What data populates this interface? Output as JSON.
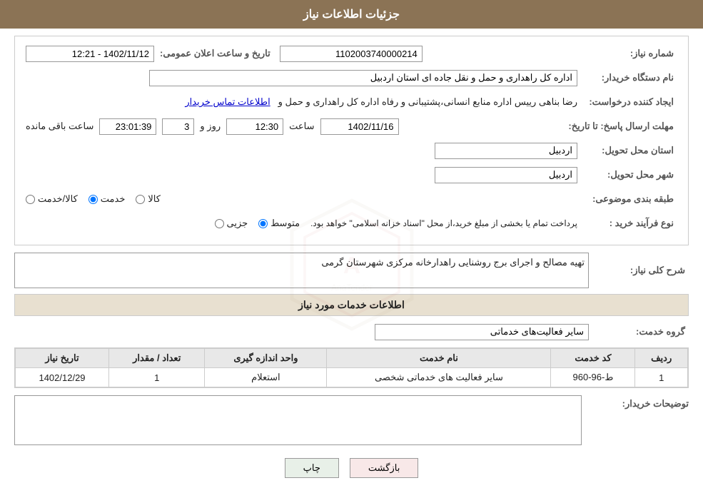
{
  "header": {
    "title": "جزئیات اطلاعات نیاز"
  },
  "fields": {
    "need_number_label": "شماره نیاز:",
    "need_number_value": "1102003740000214",
    "announce_datetime_label": "تاریخ و ساعت اعلان عمومی:",
    "announce_datetime_value": "1402/11/12 - 12:21",
    "buyer_org_label": "نام دستگاه خریدار:",
    "buyer_org_value": "اداره کل راهداری و حمل و نقل جاده ای استان اردبیل",
    "requester_label": "ایجاد کننده درخواست:",
    "requester_value": "رضا بناهی رییس اداره منابع انسانی،پشتیبانی و رفاه اداره کل راهداری و حمل و",
    "requester_link": "اطلاعات تماس خریدار",
    "reply_deadline_label": "مهلت ارسال پاسخ: تا تاریخ:",
    "reply_date": "1402/11/16",
    "reply_time_label": "ساعت",
    "reply_time": "12:30",
    "reply_day_label": "روز و",
    "reply_days": "3",
    "reply_remaining_label": "ساعت باقی مانده",
    "reply_remaining_time": "23:01:39",
    "delivery_province_label": "استان محل تحویل:",
    "delivery_province_value": "اردبیل",
    "delivery_city_label": "شهر محل تحویل:",
    "delivery_city_value": "اردبیل",
    "subject_category_label": "طبقه بندی موضوعی:",
    "subject_options": [
      {
        "label": "کالا",
        "name": "subject",
        "value": "kala",
        "checked": false
      },
      {
        "label": "خدمت",
        "name": "subject",
        "value": "khedmat",
        "checked": true
      },
      {
        "label": "کالا/خدمت",
        "name": "subject",
        "value": "kala_khedmat",
        "checked": false
      }
    ],
    "purchase_type_label": "نوع فرآیند خرید :",
    "purchase_options": [
      {
        "label": "جزیی",
        "name": "purchase",
        "value": "jozii",
        "checked": false
      },
      {
        "label": "متوسط",
        "name": "purchase",
        "value": "motavaset",
        "checked": true
      },
      {
        "label": "purchase_note",
        "text": "پرداخت تمام یا بخشی از مبلغ خرید،از محل \"اسناد خزانه اسلامی\" خواهد بود.",
        "checked": false
      }
    ],
    "purchase_note_text": "پرداخت تمام یا بخشی از مبلغ خرید،از محل \"اسناد خزانه اسلامی\" خواهد بود."
  },
  "need_description": {
    "section_title": "شرح کلی نیاز:",
    "value": "تهیه مصالح و اجرای برج روشنایی راهدارخانه مرکزی شهرستان گرمی"
  },
  "services_section": {
    "title": "اطلاعات خدمات مورد نیاز",
    "service_group_label": "گروه خدمت:",
    "service_group_value": "سایر فعالیت‌های خدماتی",
    "table": {
      "columns": [
        "ردیف",
        "کد خدمت",
        "نام خدمت",
        "واحد اندازه گیری",
        "تعداد / مقدار",
        "تاریخ نیاز"
      ],
      "rows": [
        {
          "row_num": "1",
          "service_code": "ط-96-960",
          "service_name": "سایر فعالیت های خدماتی شخصی",
          "unit": "استعلام",
          "quantity": "1",
          "need_date": "1402/12/29"
        }
      ]
    }
  },
  "buyer_description": {
    "label": "توضیحات خریدار:",
    "value": ""
  },
  "buttons": {
    "print_label": "چاپ",
    "back_label": "بازگشت"
  }
}
